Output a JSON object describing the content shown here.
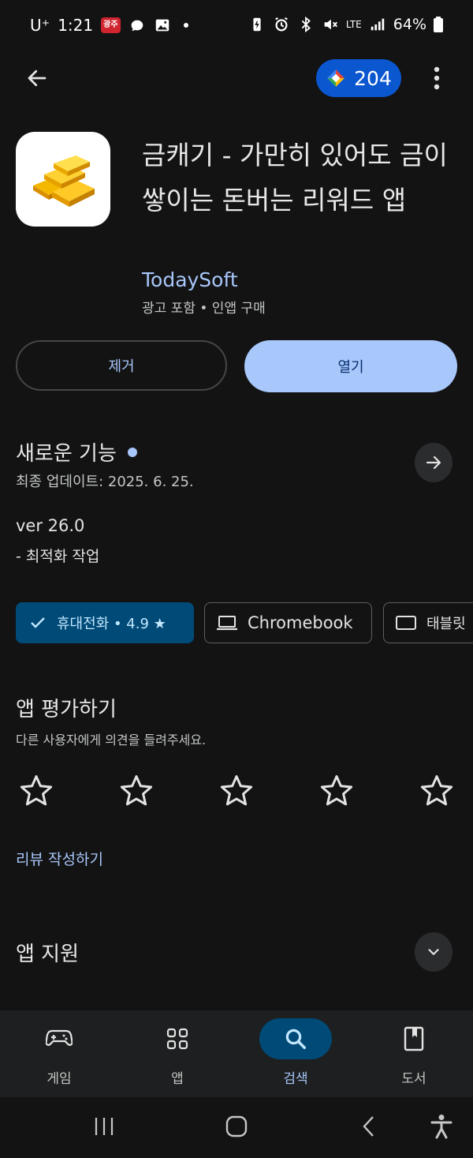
{
  "status_bar": {
    "carrier": "U⁺",
    "time": "1:21",
    "badge_text": "광주",
    "network": "LTE",
    "battery": "64%"
  },
  "top_bar": {
    "points": "204"
  },
  "app": {
    "title": "금캐기 - 가만히 있어도 금이 쌓이는 돈버는 리워드 앱",
    "developer": "TodaySoft",
    "meta": "광고 포함 • 인앱 구매",
    "uninstall_label": "제거",
    "open_label": "열기"
  },
  "whats_new": {
    "title": "새로운 기능",
    "updated": "최종 업데이트: 2025. 6. 25.",
    "version": "ver 26.0",
    "notes": "- 최적화 작업"
  },
  "devices": {
    "phone_label": "휴대전화 • 4.9 ★",
    "chromebook_label": "Chromebook",
    "tablet_label": "태블릿"
  },
  "rate": {
    "title": "앱 평가하기",
    "subtitle": "다른 사용자에게 의견을 들려주세요.",
    "star_count": 5,
    "write_review": "리뷰 작성하기"
  },
  "support": {
    "title": "앱 지원"
  },
  "bottom_nav": {
    "items": [
      {
        "label": "게임",
        "icon": "gamepad-icon"
      },
      {
        "label": "앱",
        "icon": "apps-grid-icon"
      },
      {
        "label": "검색",
        "icon": "search-icon",
        "active": true
      },
      {
        "label": "도서",
        "icon": "book-icon"
      }
    ]
  },
  "colors": {
    "background": "#131314",
    "accent": "#a8c7fa",
    "pill_blue": "#0b57d0"
  }
}
